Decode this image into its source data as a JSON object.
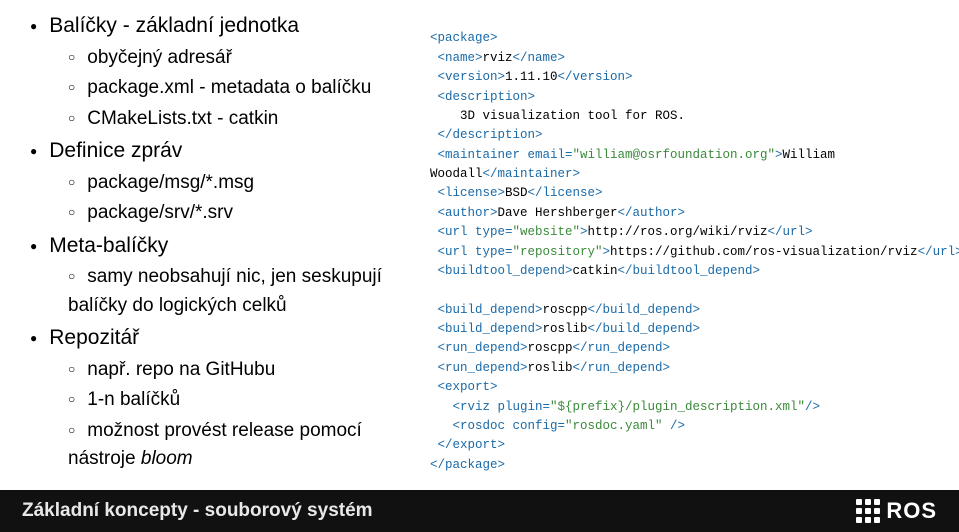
{
  "left": {
    "i0": "Balíčky - základní jednotka",
    "i0_0": "obyčejný adresář",
    "i0_1": "package.xml - metadata o balíčku",
    "i0_2": "CMakeLists.txt - catkin",
    "i1": "Definice zpráv",
    "i1_0": "package/msg/*.msg",
    "i1_1": "package/srv/*.srv",
    "i2": "Meta-balíčky",
    "i2_0": "samy neobsahují nic, jen seskupují balíčky do logických celků",
    "i3": "Repozitář",
    "i3_0": "např. repo na GitHubu",
    "i3_1": "1-n balíčků",
    "i3_2_a": "možnost provést release pomocí nástroje ",
    "i3_2_b": "bloom"
  },
  "code": {
    "l1a": "<package>",
    "l2a": " <name>",
    "l2b": "rviz",
    "l2c": "</name>",
    "l3a": " <version>",
    "l3b": "1.11.10",
    "l3c": "</version>",
    "l4a": " <description>",
    "l5a": "    3D visualization tool for ROS.",
    "l6a": " </description>",
    "l7a": " <maintainer email=",
    "l7b": "\"william@osrfoundation.org\"",
    "l7c": ">",
    "l7d": "William",
    "l8a": "Woodall",
    "l8b": "</maintainer>",
    "l9a": " <license>",
    "l9b": "BSD",
    "l9c": "</license>",
    "l10a": " <author>",
    "l10b": "Dave Hershberger",
    "l10c": "</author>",
    "l11a": " <url type=",
    "l11b": "\"website\"",
    "l11c": ">",
    "l11d": "http://ros.org/wiki/rviz",
    "l11e": "</url>",
    "l12a": " <url type=",
    "l12b": "\"repository\"",
    "l12c": ">",
    "l12d": "https://github.com/ros-visualization/rviz",
    "l12e": "</url>",
    "l13a": " <buildtool_depend>",
    "l13b": "catkin",
    "l13c": "</buildtool_depend>",
    "l14": "",
    "l15a": " <build_depend>",
    "l15b": "roscpp",
    "l15c": "</build_depend>",
    "l16a": " <build_depend>",
    "l16b": "roslib",
    "l16c": "</build_depend>",
    "l17a": " <run_depend>",
    "l17b": "roscpp",
    "l17c": "</run_depend>",
    "l18a": " <run_depend>",
    "l18b": "roslib",
    "l18c": "</run_depend>",
    "l19a": " <export>",
    "l20a": "   <rviz plugin=",
    "l20b": "\"${prefix}/plugin_description.xml\"",
    "l20c": "/>",
    "l21a": "   <rosdoc config=",
    "l21b": "\"rosdoc.yaml\"",
    "l21c": " />",
    "l22a": " </export>",
    "l23a": "</package>"
  },
  "footer": {
    "title": "Základní koncepty - souborový systém",
    "logo": "ROS"
  }
}
